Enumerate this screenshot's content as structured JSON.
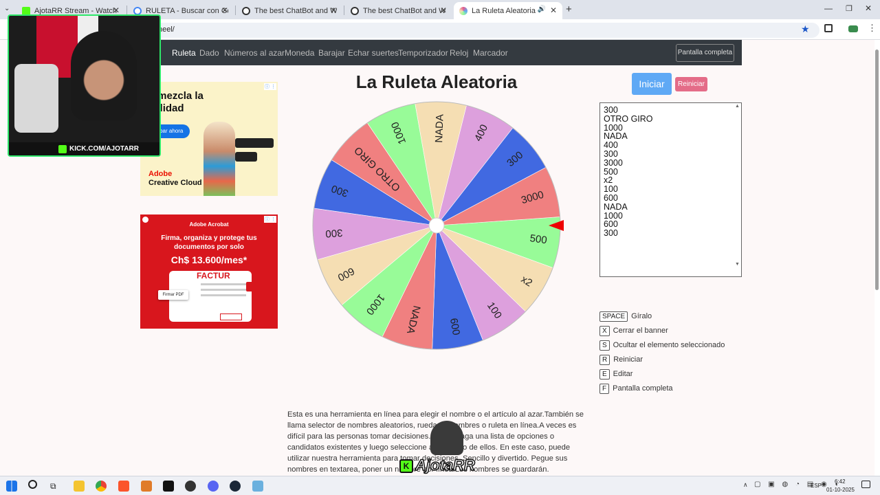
{
  "browser": {
    "tabs": [
      {
        "title": "AjotaRR Stream - Watch Live on",
        "color": "#53fc18"
      },
      {
        "title": "RULETA - Buscar con Google",
        "color": "#4285f4"
      },
      {
        "title": "The best ChatBot and Widgets",
        "color": "#333333"
      },
      {
        "title": "The best ChatBot and Widgets",
        "color": "#333333"
      },
      {
        "title": "La Ruleta Aleatoria",
        "color": "#e45b8c"
      }
    ],
    "url": "heel/"
  },
  "nav": {
    "items": [
      "Ruleta",
      "Dado",
      "Números al azar",
      "Moneda",
      "Barajar",
      "Echar suertes",
      "Temporizador",
      "Reloj",
      "Marcador"
    ],
    "fullscreen": "Pantalla completa"
  },
  "title": "La Ruleta Aleatoria",
  "buttons": {
    "start": "Iniciar",
    "reset": "Reiniciar"
  },
  "names_text": "300\nOTRO GIRO\n1000\nNADA\n400\n300\n3000\n500\nx2\n100\n600\nNADA\n1000\n600\n300",
  "wheel": {
    "segments": [
      {
        "label": "500",
        "color": "#98fb98"
      },
      {
        "label": "x2",
        "color": "#f5deb3"
      },
      {
        "label": "100",
        "color": "#dda0dd"
      },
      {
        "label": "600",
        "color": "#4169e1"
      },
      {
        "label": "NADA",
        "color": "#f08080"
      },
      {
        "label": "1000",
        "color": "#98fb98"
      },
      {
        "label": "600",
        "color": "#f5deb3"
      },
      {
        "label": "300",
        "color": "#dda0dd"
      },
      {
        "label": "300",
        "color": "#4169e1"
      },
      {
        "label": "OTRO GIRO",
        "color": "#f08080"
      },
      {
        "label": "1000",
        "color": "#98fb98"
      },
      {
        "label": "NADA",
        "color": "#f5deb3"
      },
      {
        "label": "400",
        "color": "#dda0dd"
      },
      {
        "label": "300",
        "color": "#4169e1"
      },
      {
        "label": "3000",
        "color": "#f08080"
      }
    ]
  },
  "shortcuts": [
    {
      "key": "SPACE",
      "label": "Gíralo"
    },
    {
      "key": "X",
      "label": "Cerrar el banner"
    },
    {
      "key": "S",
      "label": "Ocultar el elemento seleccionado"
    },
    {
      "key": "R",
      "label": "Reiniciar"
    },
    {
      "key": "E",
      "label": "Editar"
    },
    {
      "key": "F",
      "label": "Pantalla completa"
    }
  ],
  "description": "Esta es una herramienta en línea para elegir el nombre o el artículo al azar.También se llama selector de nombres aleatorios, rueda de nombres o ruleta en línea.A veces es difícil para las personas tomar decisiones. Luego haga una lista de opciones o candidatos existentes y luego seleccione al azar uno de ellos. En este caso, puede utilizar nuestra herramienta para tomar decisiones. Sencillo y divertido. Pegue sus nombres en textarea, poner un nombre por línea.Los nombres se guardarán. Simplemente haga clic en la rueda",
  "ad1": {
    "headline": "Remezcla la realidad",
    "cta": "Probar ahora",
    "brand": "Adobe",
    "product": "Creative Cloud"
  },
  "ad2": {
    "brand": "Adobe Acrobat",
    "line": "Firma, organiza y protege tus documentos por solo",
    "price": "Ch$ 13.600/mes*",
    "doc": "FACTUR",
    "sign": "Firmar PDF"
  },
  "stream": {
    "channel": "KICK.COM/AJOTARR",
    "logo": "AjotaRR"
  },
  "taskbar": {
    "lang": "ESP",
    "time": "6:42",
    "date": "01-10-2025"
  }
}
